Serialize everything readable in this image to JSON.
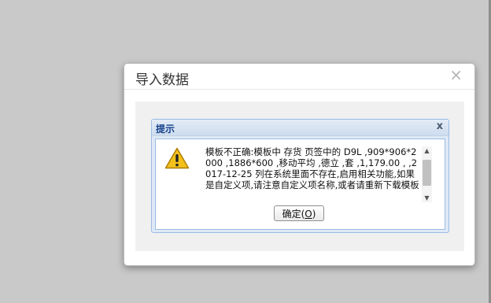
{
  "modal": {
    "title": "导入数据",
    "close_glyph": "×"
  },
  "alert": {
    "title": "提示",
    "close_glyph": "x",
    "icon": "warning-icon",
    "message": "模板不正确:模板中 存货 页签中的 D9L ,909*906*2000 ,1886*600 ,移动平均 ,德立 ,套 ,1,179.00 , ,2017-12-25 列在系统里面不存在,启用相关功能,如果是自定义项,请注意自定义项名称,或者请重新下载模板",
    "ok_label": "确定(",
    "ok_key": "O",
    "ok_suffix": ")"
  },
  "colors": {
    "overlay_bg": "#c9c9c9",
    "alert_title": "#15428b",
    "alert_border": "#99bbe8",
    "warning_fill": "#f2c21b"
  }
}
